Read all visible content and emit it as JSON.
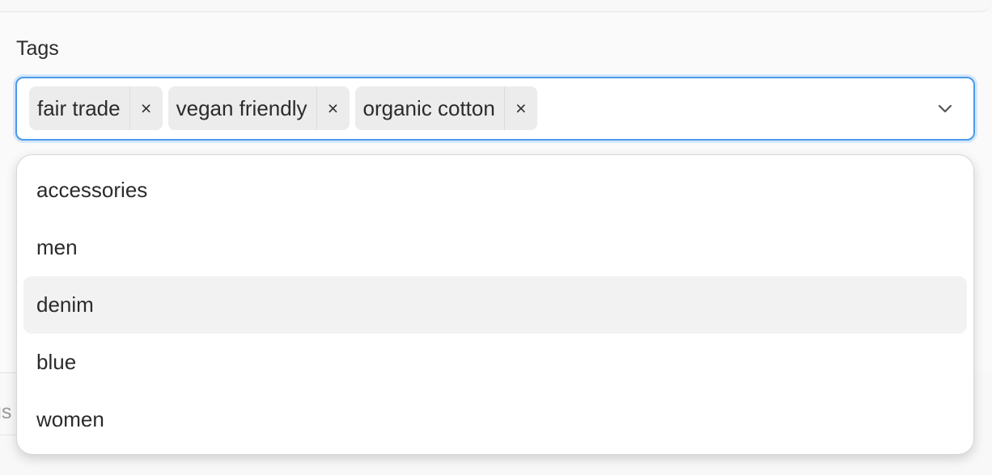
{
  "field": {
    "label": "Tags"
  },
  "selected_tags": [
    {
      "label": "fair trade",
      "remove_symbol": "×"
    },
    {
      "label": "vegan friendly",
      "remove_symbol": "×"
    },
    {
      "label": "organic cotton",
      "remove_symbol": "×"
    }
  ],
  "dropdown": {
    "toggle_icon": "chevron-down-icon",
    "options": [
      {
        "label": "accessories",
        "highlighted": false
      },
      {
        "label": "men",
        "highlighted": false
      },
      {
        "label": "denim",
        "highlighted": true
      },
      {
        "label": "blue",
        "highlighted": false
      },
      {
        "label": "women",
        "highlighted": false
      }
    ]
  },
  "background_partial_text": "us",
  "colors": {
    "focus_border": "#4b9ae8",
    "focus_ring": "#d5e7fb",
    "tag_background": "#ececec",
    "highlight_background": "#f2f2f2"
  }
}
